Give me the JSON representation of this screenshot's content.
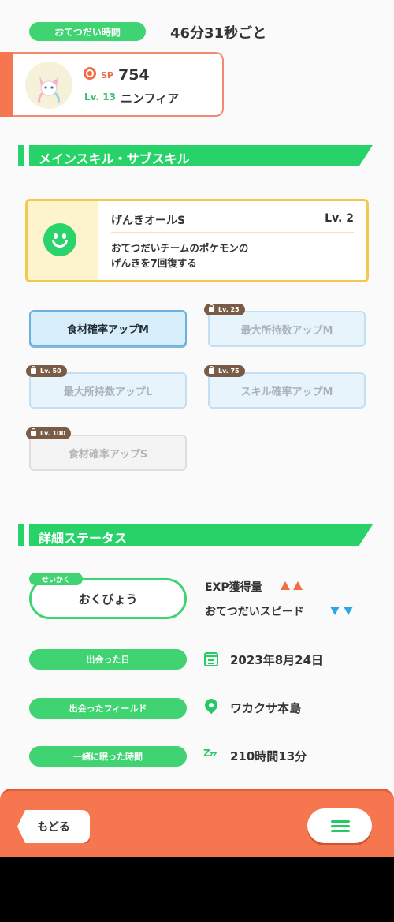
{
  "help_time": {
    "label": "おてつだい時間",
    "value": "46分31秒ごと"
  },
  "pokemon": {
    "sp_label": "SP",
    "sp_value": "754",
    "level": "Lv. 13",
    "name": "ニンフィア"
  },
  "sections": {
    "skills_title": "メインスキル・サブスキル",
    "details_title": "詳細ステータス"
  },
  "main_skill": {
    "name": "げんきオールS",
    "level": "Lv. 2",
    "description_line1": "おてつだいチームのポケモンの",
    "description_line2": "げんきを7回復する"
  },
  "sub_skills": [
    {
      "label": "食材確率アップM",
      "lock": ""
    },
    {
      "label": "最大所持数アップM",
      "lock": "Lv. 25"
    },
    {
      "label": "最大所持数アップL",
      "lock": "Lv. 50"
    },
    {
      "label": "スキル確率アップM",
      "lock": "Lv. 75"
    },
    {
      "label": "食材確率アップS",
      "lock": "Lv. 100"
    }
  ],
  "nature": {
    "tag": "せいかく",
    "name": "おくびょう",
    "up_stat": "EXP獲得量",
    "down_stat": "おてつだいスピード"
  },
  "details": {
    "met_date_label": "出会った日",
    "met_date_value": "2023年8月24日",
    "met_field_label": "出会ったフィールド",
    "met_field_value": "ワカクサ本島",
    "sleep_time_label": "一緒に眠った時間",
    "sleep_time_value": "210時間13分"
  },
  "footer": {
    "back_label": "もどる"
  },
  "colors": {
    "green": "#3fd371",
    "orange": "#f5764f",
    "up": "#f26d42",
    "down": "#2ba6e8"
  }
}
